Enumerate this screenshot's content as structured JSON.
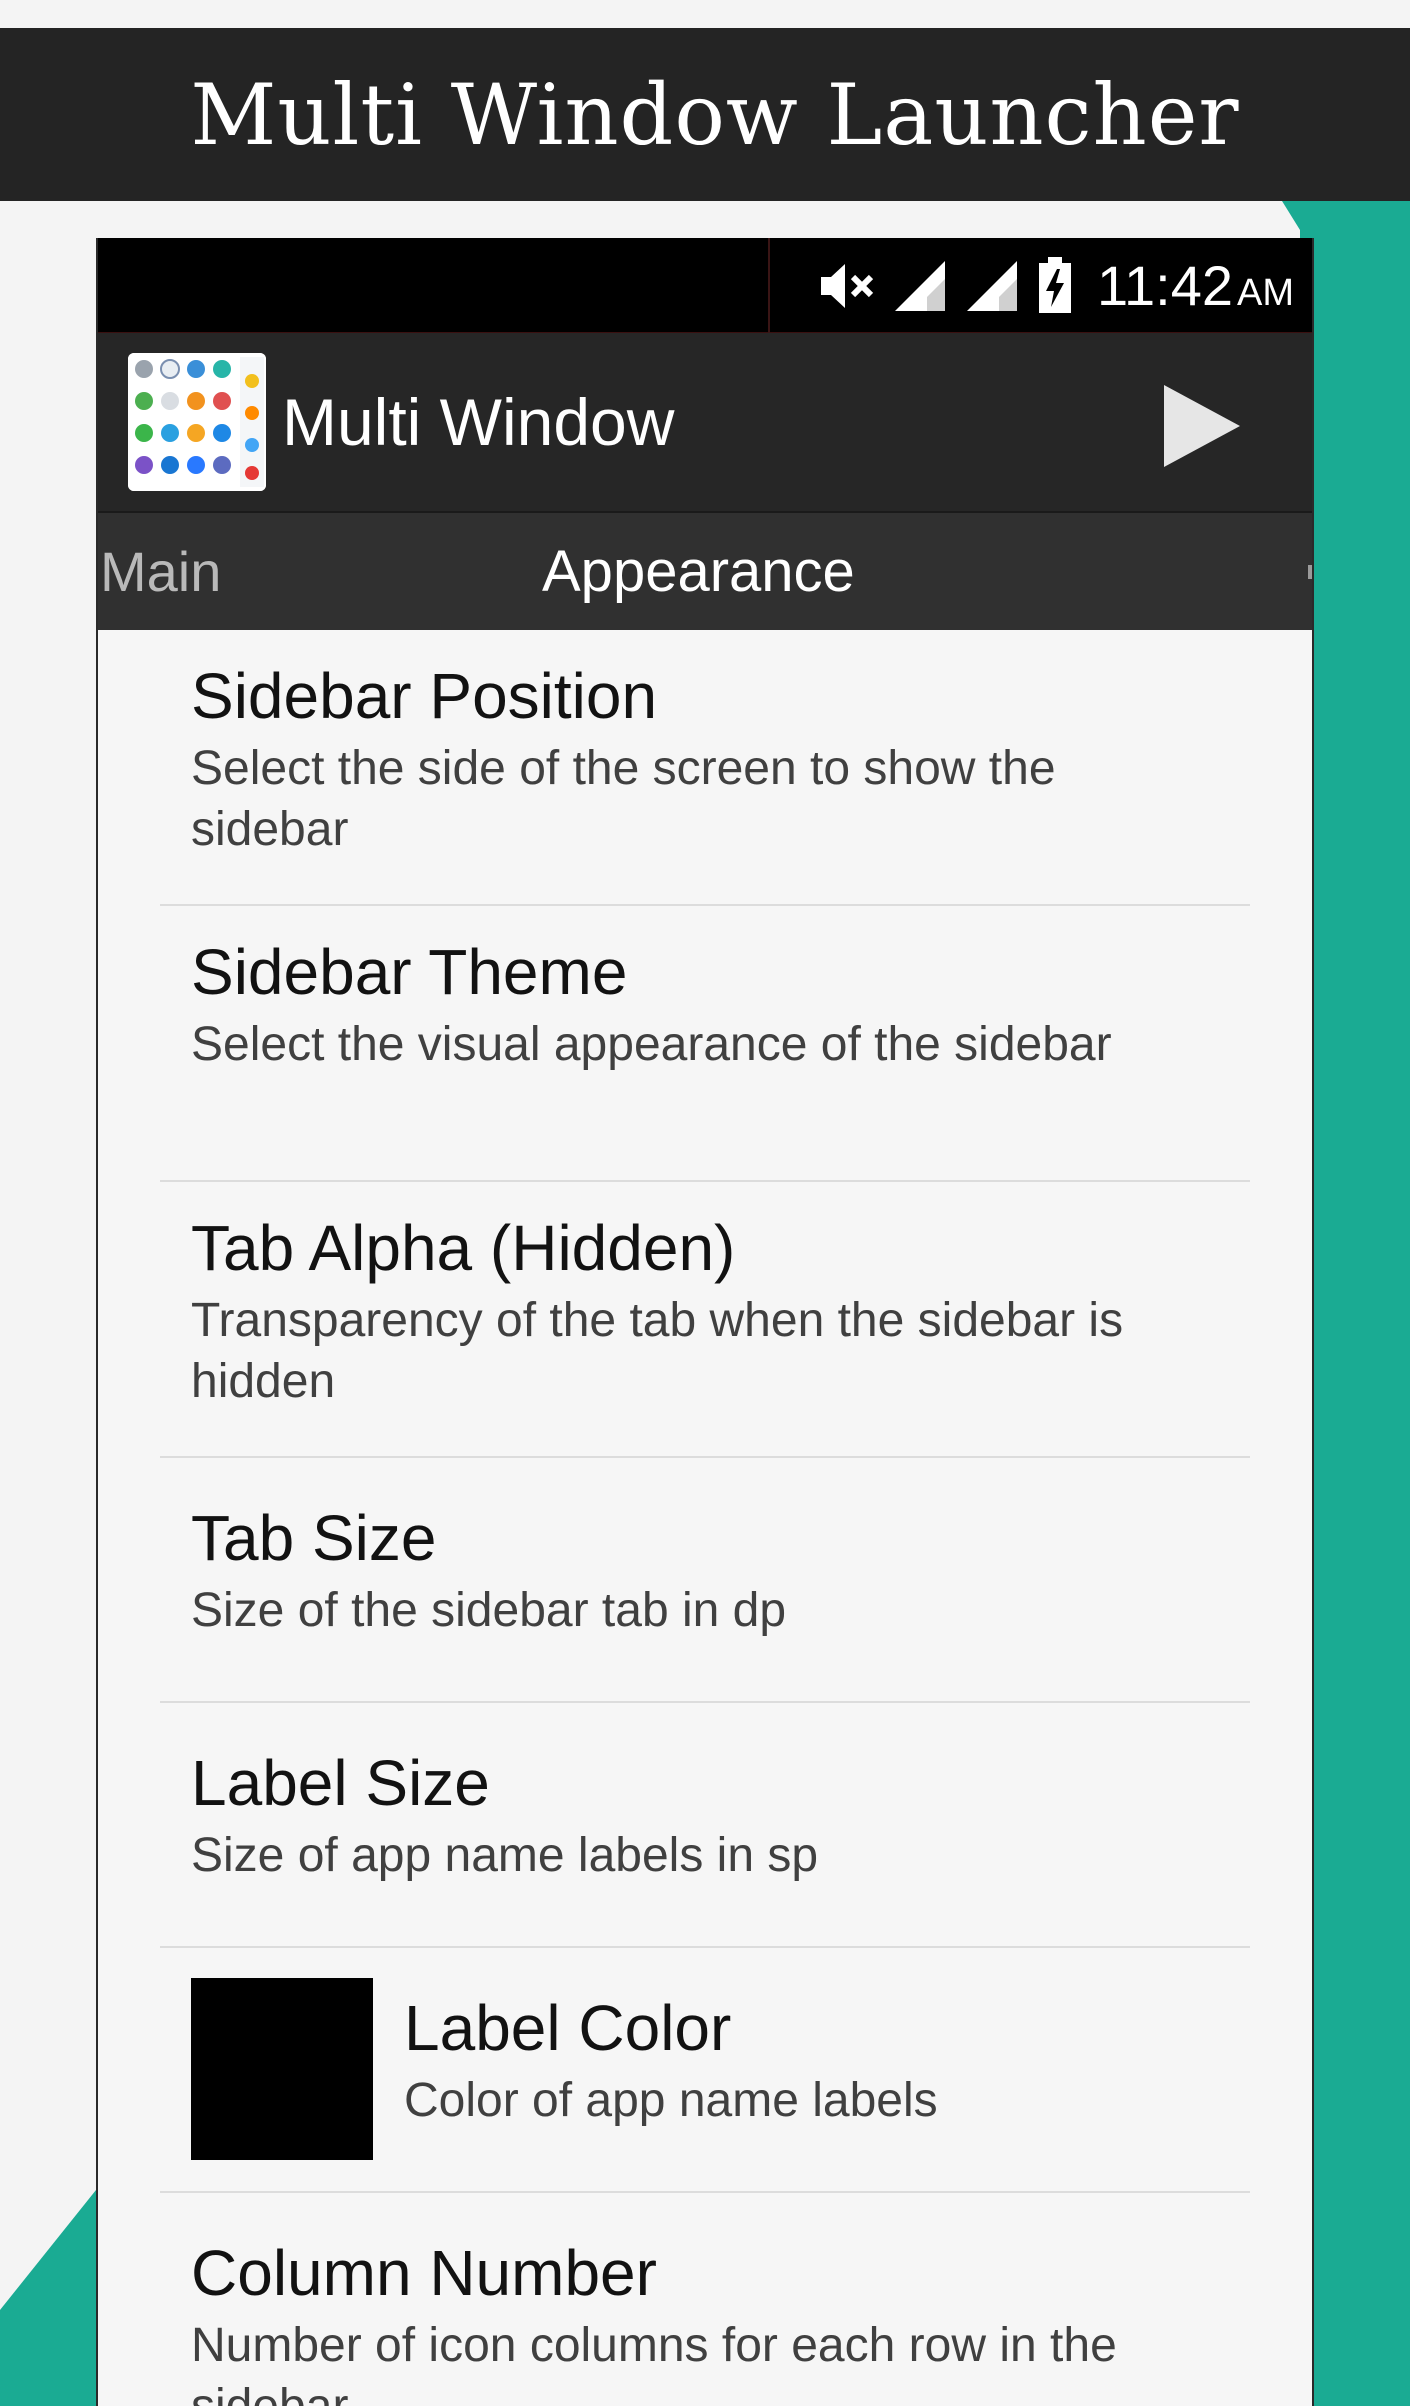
{
  "banner": {
    "title": "Multi Window Launcher"
  },
  "status_bar": {
    "time": "11:42",
    "ampm": "AM",
    "icons": [
      "mute-icon",
      "signal-icon",
      "signal-icon",
      "battery-charging-icon"
    ]
  },
  "action_bar": {
    "app_title": "Multi Window",
    "play_icon": "play-icon"
  },
  "tabs": [
    {
      "label": "Main",
      "selected": false
    },
    {
      "label": "Appearance",
      "selected": true
    }
  ],
  "preferences": [
    {
      "title": "Sidebar Position",
      "summary": "Select the side of the screen to show the sidebar"
    },
    {
      "title": "Sidebar Theme",
      "summary": "Select the visual appearance of the sidebar"
    },
    {
      "title": "Tab Alpha (Hidden)",
      "summary": "Transparency of the tab when the sidebar is hidden"
    },
    {
      "title": "Tab Size",
      "summary": "Size of the sidebar tab in dp"
    },
    {
      "title": "Label Size",
      "summary": "Size of app name labels in sp"
    },
    {
      "title": "Label Color",
      "summary": "Color of app name labels",
      "swatch": "#000000"
    },
    {
      "title": "Column Number",
      "summary": "Number of icon columns for each row in the sidebar"
    }
  ],
  "colors": {
    "teal": "#1aab93",
    "banner": "#242424",
    "actionbar": "#262626",
    "tabbar": "#303030"
  }
}
